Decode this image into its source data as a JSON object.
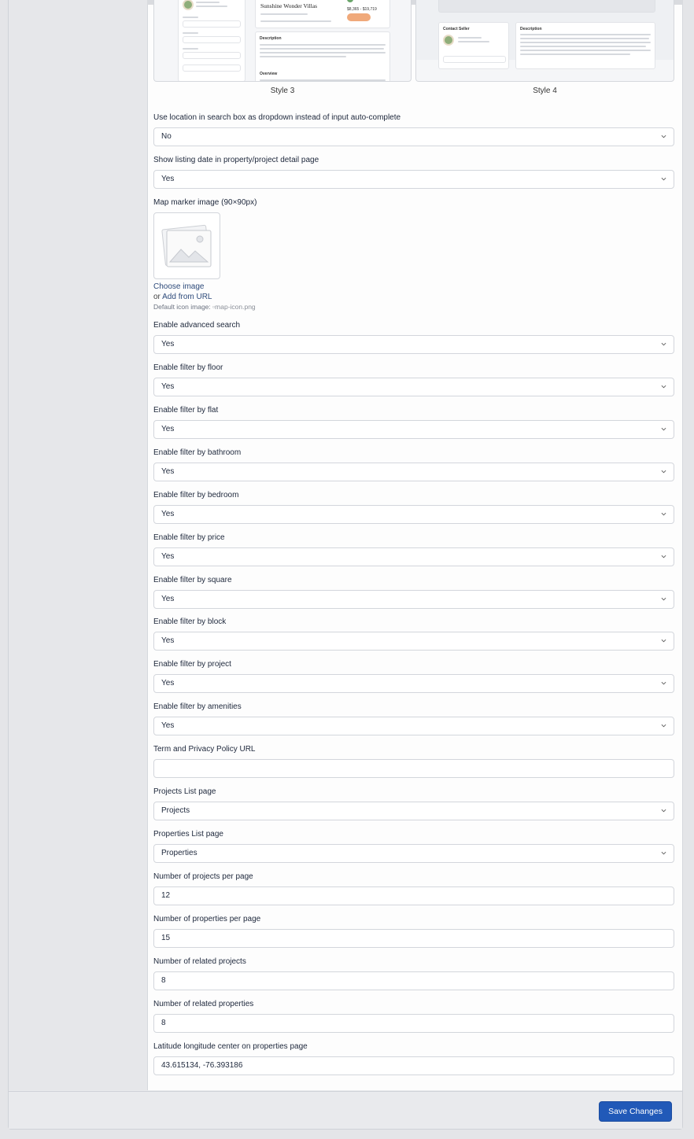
{
  "styles": {
    "style3_caption": "Style 3",
    "style4_caption": "Style 4",
    "style3_preview": {
      "title": "Sunshine Wonder Villas",
      "price": "$8,365 - $19,719",
      "section_description": "Description",
      "section_overview": "Overview"
    },
    "style4_preview": {
      "contact_label": "Contact Seller",
      "section_description": "Description"
    }
  },
  "fields": {
    "location_dropdown": {
      "label": "Use location in search box as dropdown instead of input auto-complete",
      "value": "No"
    },
    "show_listing_date": {
      "label": "Show listing date in property/project detail page",
      "value": "Yes"
    },
    "map_marker": {
      "label": "Map marker image (90×90px)",
      "choose": "Choose image",
      "or": "or",
      "add_url": "Add from URL",
      "default_hint": "Default icon image:",
      "default_alt": "map-icon.png"
    },
    "advanced_search": {
      "label": "Enable advanced search",
      "value": "Yes"
    },
    "filter_floor": {
      "label": "Enable filter by floor",
      "value": "Yes"
    },
    "filter_flat": {
      "label": "Enable filter by flat",
      "value": "Yes"
    },
    "filter_bathroom": {
      "label": "Enable filter by bathroom",
      "value": "Yes"
    },
    "filter_bedroom": {
      "label": "Enable filter by bedroom",
      "value": "Yes"
    },
    "filter_price": {
      "label": "Enable filter by price",
      "value": "Yes"
    },
    "filter_square": {
      "label": "Enable filter by square",
      "value": "Yes"
    },
    "filter_block": {
      "label": "Enable filter by block",
      "value": "Yes"
    },
    "filter_project": {
      "label": "Enable filter by project",
      "value": "Yes"
    },
    "filter_amenities": {
      "label": "Enable filter by amenities",
      "value": "Yes"
    },
    "term_privacy": {
      "label": "Term and Privacy Policy URL",
      "value": ""
    },
    "projects_list_page": {
      "label": "Projects List page",
      "value": "Projects"
    },
    "properties_list_page": {
      "label": "Properties List page",
      "value": "Properties"
    },
    "projects_per_page": {
      "label": "Number of projects per page",
      "value": "12"
    },
    "properties_per_page": {
      "label": "Number of properties per page",
      "value": "15"
    },
    "related_projects": {
      "label": "Number of related projects",
      "value": "8"
    },
    "related_properties": {
      "label": "Number of related properties",
      "value": "8"
    },
    "lat_long_center": {
      "label": "Latitude longitude center on properties page",
      "value": "43.615134, -76.393186"
    }
  },
  "footer": {
    "save_label": "Save Changes"
  },
  "colors": {
    "primary": "#2159b8",
    "border": "#d3d6dc",
    "text": "#1d273b"
  }
}
